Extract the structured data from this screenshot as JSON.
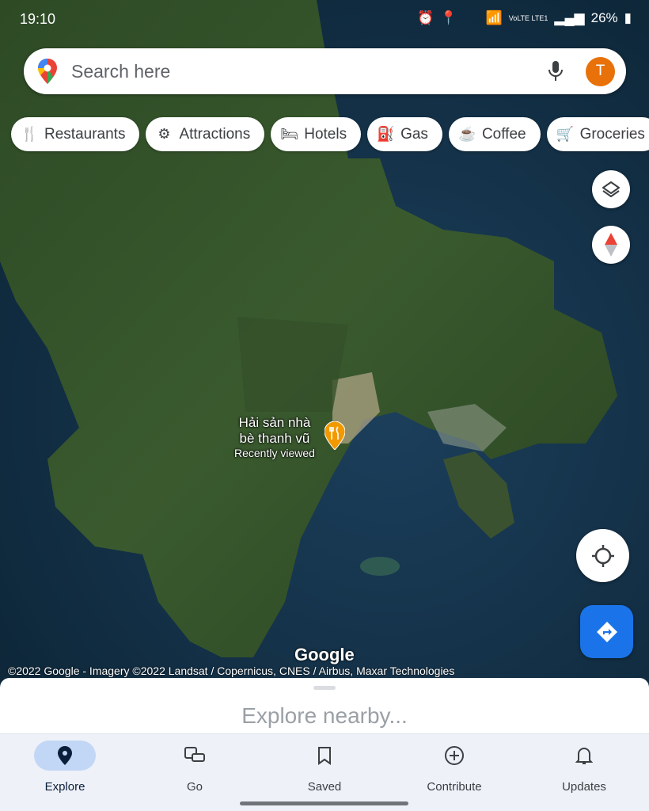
{
  "status_bar": {
    "time": "19:10",
    "network": "VoLTE LTE1",
    "battery": "26%"
  },
  "search": {
    "placeholder": "Search here",
    "avatar_letter": "T"
  },
  "chips": [
    {
      "label": "Restaurants",
      "icon": "fork-knife-icon",
      "glyph": "🍴"
    },
    {
      "label": "Attractions",
      "icon": "ferris-wheel-icon",
      "glyph": "⚙"
    },
    {
      "label": "Hotels",
      "icon": "bed-icon",
      "glyph": "🛏"
    },
    {
      "label": "Gas",
      "icon": "gas-pump-icon",
      "glyph": "⛽"
    },
    {
      "label": "Coffee",
      "icon": "coffee-cup-icon",
      "glyph": "☕"
    },
    {
      "label": "Groceries",
      "icon": "cart-icon",
      "glyph": "🛒"
    }
  ],
  "map": {
    "poi_name_line1": "Hải sản nhà",
    "poi_name_line2": "bè thanh vũ",
    "poi_subtitle": "Recently viewed",
    "logo": "Google",
    "attribution": "©2022 Google - Imagery ©2022 Landsat / Copernicus, CNES / Airbus, Maxar Technologies",
    "poi_color": "#f29900"
  },
  "sheet": {
    "title": "Explore nearby..."
  },
  "nav": [
    {
      "label": "Explore",
      "active": true
    },
    {
      "label": "Go"
    },
    {
      "label": "Saved"
    },
    {
      "label": "Contribute"
    },
    {
      "label": "Updates"
    }
  ],
  "colors": {
    "accent": "#1a73e8",
    "avatar": "#e8710a",
    "active_pill": "#c2d7f5"
  }
}
